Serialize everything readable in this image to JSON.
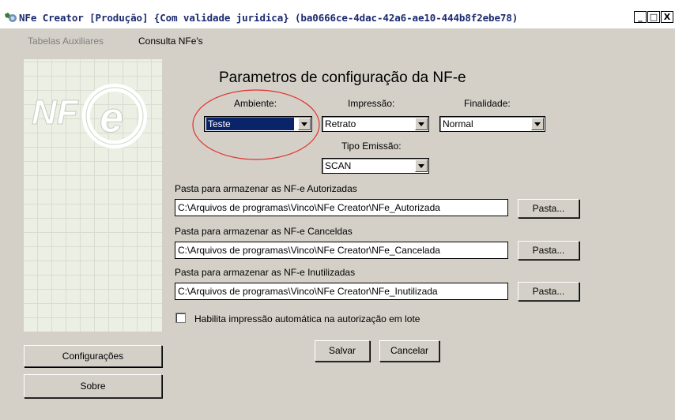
{
  "window": {
    "title": "NFe Creator [Produção] {Com validade juridica} (ba0666ce-4dac-42a6-ae10-444b8f2ebe78)",
    "controls": [
      "_",
      "□",
      "X"
    ]
  },
  "menu": {
    "items": [
      {
        "label": "Tabelas Auxiliares",
        "enabled": false
      },
      {
        "label": "Consulta NFe's",
        "enabled": true
      }
    ]
  },
  "logo": {
    "text": "NF e"
  },
  "heading": "Parametros de configuração da NF-e",
  "ambiente": {
    "label": "Ambiente:",
    "value": "Teste"
  },
  "impressao": {
    "label": "Impressão:",
    "value": "Retrato"
  },
  "finalidade": {
    "label": "Finalidade:",
    "value": "Normal"
  },
  "tipo_emissao": {
    "label": "Tipo Emissão:",
    "value": "SCAN"
  },
  "folders": [
    {
      "label": "Pasta para armazenar as NF-e Autorizadas",
      "value": "C:\\Arquivos de programas\\Vinco\\NFe Creator\\NFe_Autorizada",
      "button": "Pasta..."
    },
    {
      "label": "Pasta para armazenar as NF-e Canceldas",
      "value": "C:\\Arquivos de programas\\Vinco\\NFe Creator\\NFe_Cancelada",
      "button": "Pasta..."
    },
    {
      "label": "Pasta para armazenar as NF-e Inutilizadas",
      "value": "C:\\Arquivos de programas\\Vinco\\NFe Creator\\NFe_Inutilizada",
      "button": "Pasta..."
    }
  ],
  "auto_print": {
    "label": "Habilita impressão automática na autorização em lote",
    "checked": false
  },
  "buttons": {
    "save": "Salvar",
    "cancel": "Cancelar",
    "config": "Configurações",
    "about": "Sobre"
  },
  "colors": {
    "annotation": "#e0302a",
    "selection": "#0a246a"
  }
}
